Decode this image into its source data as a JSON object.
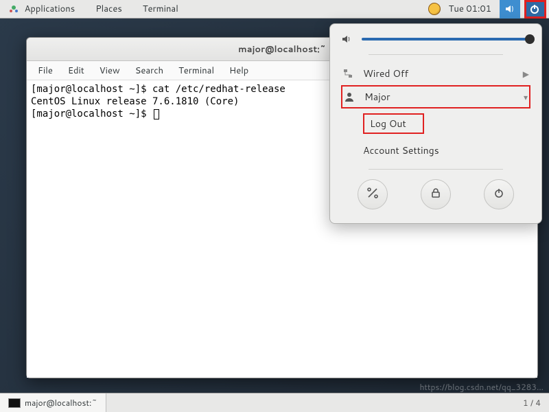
{
  "panel": {
    "applications": "Applications",
    "places": "Places",
    "terminal": "Terminal",
    "datetime": "Tue 01:01"
  },
  "window": {
    "title": "major@localhost:~",
    "menubar": [
      "File",
      "Edit",
      "View",
      "Search",
      "Terminal",
      "Help"
    ]
  },
  "terminal": {
    "line1": "[major@localhost ~]$ cat /etc/redhat-release",
    "line2": "CentOS Linux release 7.6.1810 (Core)",
    "line3": "[major@localhost ~]$ "
  },
  "popover": {
    "network_label": "Wired Off",
    "user_label": "Major",
    "logout_label": "Log Out",
    "account_settings_label": "Account Settings"
  },
  "taskbar": {
    "task_label": "major@localhost:~",
    "pager": "1 / 4"
  },
  "watermark": "https://blog.csdn.net/qq_3283..."
}
